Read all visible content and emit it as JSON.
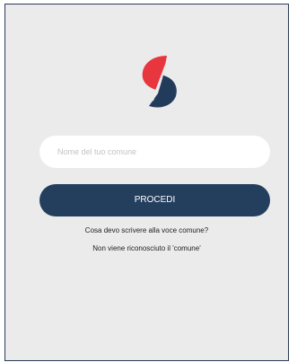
{
  "status_bar": {
    "carrier": "",
    "time": "",
    "battery": ""
  },
  "logo": {
    "icon": "app-logo-s",
    "colors": {
      "red": "#e8363f",
      "navy": "#233b5b"
    }
  },
  "form": {
    "comune_placeholder": "Nome del tuo comune",
    "comune_value": "",
    "submit_label": "PROCEDI"
  },
  "links": {
    "help_comune": "Cosa devo scrivere alla voce comune?",
    "not_recognized": "Non viene riconosciuto il 'comune'"
  },
  "colors": {
    "background": "#ebebeb",
    "button": "#243f5e",
    "input_bg": "#ffffff"
  }
}
